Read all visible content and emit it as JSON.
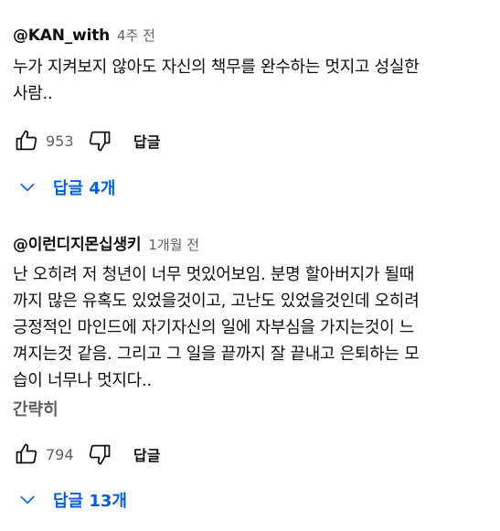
{
  "comments": [
    {
      "author": "@KAN_with",
      "time": "4주 전",
      "text": "누가 지켜보지 않아도 자신의 책무를 완수하는 멋지고 성실한\n사람..",
      "likes": "953",
      "reply_label": "답글",
      "replies_label": "답글 4개"
    },
    {
      "author": "@이런디지몬십생키",
      "time": "1개월 전",
      "text": "난 오히려 저 청년이 너무 멋있어보임. 분명 할아버지가 될때\n까지 많은 유혹도 있었을것이고, 고난도 있었을것인데 오히려\n긍정적인 마인드에 자기자신의 일에 자부심을 가지는것이 느\n껴지는것 같음. 그리고 그 일을 끝까지 잘 끝내고 은퇴하는 모\n습이 너무나 멋지다..",
      "read_more": "간략히",
      "likes": "794",
      "reply_label": "답글",
      "replies_label": "답글 13개"
    }
  ],
  "icons": [
    "thumbs-up-icon",
    "thumbs-down-icon",
    "chevron-down-icon"
  ],
  "colors": {
    "link": "#065fd4",
    "secondary_text": "#606060"
  }
}
